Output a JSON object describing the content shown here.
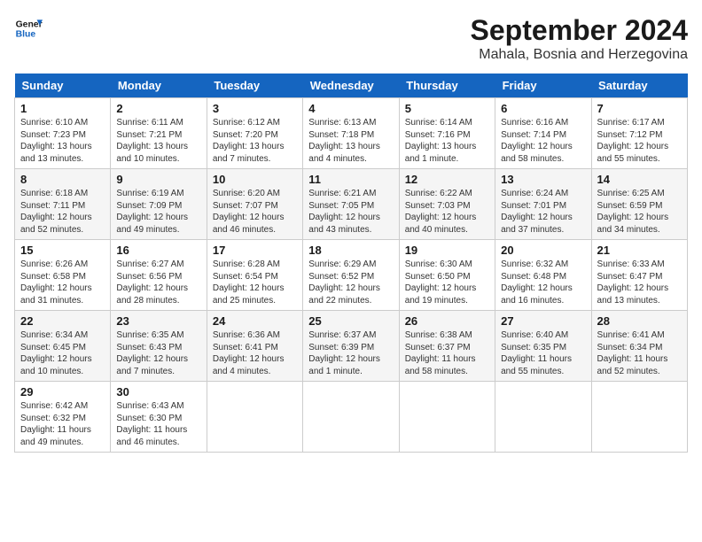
{
  "logo": {
    "line1": "General",
    "line2": "Blue"
  },
  "title": "September 2024",
  "location": "Mahala, Bosnia and Herzegovina",
  "days_of_week": [
    "Sunday",
    "Monday",
    "Tuesday",
    "Wednesday",
    "Thursday",
    "Friday",
    "Saturday"
  ],
  "weeks": [
    [
      {
        "day": "1",
        "sunrise": "Sunrise: 6:10 AM",
        "sunset": "Sunset: 7:23 PM",
        "daylight": "Daylight: 13 hours and 13 minutes."
      },
      {
        "day": "2",
        "sunrise": "Sunrise: 6:11 AM",
        "sunset": "Sunset: 7:21 PM",
        "daylight": "Daylight: 13 hours and 10 minutes."
      },
      {
        "day": "3",
        "sunrise": "Sunrise: 6:12 AM",
        "sunset": "Sunset: 7:20 PM",
        "daylight": "Daylight: 13 hours and 7 minutes."
      },
      {
        "day": "4",
        "sunrise": "Sunrise: 6:13 AM",
        "sunset": "Sunset: 7:18 PM",
        "daylight": "Daylight: 13 hours and 4 minutes."
      },
      {
        "day": "5",
        "sunrise": "Sunrise: 6:14 AM",
        "sunset": "Sunset: 7:16 PM",
        "daylight": "Daylight: 13 hours and 1 minute."
      },
      {
        "day": "6",
        "sunrise": "Sunrise: 6:16 AM",
        "sunset": "Sunset: 7:14 PM",
        "daylight": "Daylight: 12 hours and 58 minutes."
      },
      {
        "day": "7",
        "sunrise": "Sunrise: 6:17 AM",
        "sunset": "Sunset: 7:12 PM",
        "daylight": "Daylight: 12 hours and 55 minutes."
      }
    ],
    [
      {
        "day": "8",
        "sunrise": "Sunrise: 6:18 AM",
        "sunset": "Sunset: 7:11 PM",
        "daylight": "Daylight: 12 hours and 52 minutes."
      },
      {
        "day": "9",
        "sunrise": "Sunrise: 6:19 AM",
        "sunset": "Sunset: 7:09 PM",
        "daylight": "Daylight: 12 hours and 49 minutes."
      },
      {
        "day": "10",
        "sunrise": "Sunrise: 6:20 AM",
        "sunset": "Sunset: 7:07 PM",
        "daylight": "Daylight: 12 hours and 46 minutes."
      },
      {
        "day": "11",
        "sunrise": "Sunrise: 6:21 AM",
        "sunset": "Sunset: 7:05 PM",
        "daylight": "Daylight: 12 hours and 43 minutes."
      },
      {
        "day": "12",
        "sunrise": "Sunrise: 6:22 AM",
        "sunset": "Sunset: 7:03 PM",
        "daylight": "Daylight: 12 hours and 40 minutes."
      },
      {
        "day": "13",
        "sunrise": "Sunrise: 6:24 AM",
        "sunset": "Sunset: 7:01 PM",
        "daylight": "Daylight: 12 hours and 37 minutes."
      },
      {
        "day": "14",
        "sunrise": "Sunrise: 6:25 AM",
        "sunset": "Sunset: 6:59 PM",
        "daylight": "Daylight: 12 hours and 34 minutes."
      }
    ],
    [
      {
        "day": "15",
        "sunrise": "Sunrise: 6:26 AM",
        "sunset": "Sunset: 6:58 PM",
        "daylight": "Daylight: 12 hours and 31 minutes."
      },
      {
        "day": "16",
        "sunrise": "Sunrise: 6:27 AM",
        "sunset": "Sunset: 6:56 PM",
        "daylight": "Daylight: 12 hours and 28 minutes."
      },
      {
        "day": "17",
        "sunrise": "Sunrise: 6:28 AM",
        "sunset": "Sunset: 6:54 PM",
        "daylight": "Daylight: 12 hours and 25 minutes."
      },
      {
        "day": "18",
        "sunrise": "Sunrise: 6:29 AM",
        "sunset": "Sunset: 6:52 PM",
        "daylight": "Daylight: 12 hours and 22 minutes."
      },
      {
        "day": "19",
        "sunrise": "Sunrise: 6:30 AM",
        "sunset": "Sunset: 6:50 PM",
        "daylight": "Daylight: 12 hours and 19 minutes."
      },
      {
        "day": "20",
        "sunrise": "Sunrise: 6:32 AM",
        "sunset": "Sunset: 6:48 PM",
        "daylight": "Daylight: 12 hours and 16 minutes."
      },
      {
        "day": "21",
        "sunrise": "Sunrise: 6:33 AM",
        "sunset": "Sunset: 6:47 PM",
        "daylight": "Daylight: 12 hours and 13 minutes."
      }
    ],
    [
      {
        "day": "22",
        "sunrise": "Sunrise: 6:34 AM",
        "sunset": "Sunset: 6:45 PM",
        "daylight": "Daylight: 12 hours and 10 minutes."
      },
      {
        "day": "23",
        "sunrise": "Sunrise: 6:35 AM",
        "sunset": "Sunset: 6:43 PM",
        "daylight": "Daylight: 12 hours and 7 minutes."
      },
      {
        "day": "24",
        "sunrise": "Sunrise: 6:36 AM",
        "sunset": "Sunset: 6:41 PM",
        "daylight": "Daylight: 12 hours and 4 minutes."
      },
      {
        "day": "25",
        "sunrise": "Sunrise: 6:37 AM",
        "sunset": "Sunset: 6:39 PM",
        "daylight": "Daylight: 12 hours and 1 minute."
      },
      {
        "day": "26",
        "sunrise": "Sunrise: 6:38 AM",
        "sunset": "Sunset: 6:37 PM",
        "daylight": "Daylight: 11 hours and 58 minutes."
      },
      {
        "day": "27",
        "sunrise": "Sunrise: 6:40 AM",
        "sunset": "Sunset: 6:35 PM",
        "daylight": "Daylight: 11 hours and 55 minutes."
      },
      {
        "day": "28",
        "sunrise": "Sunrise: 6:41 AM",
        "sunset": "Sunset: 6:34 PM",
        "daylight": "Daylight: 11 hours and 52 minutes."
      }
    ],
    [
      {
        "day": "29",
        "sunrise": "Sunrise: 6:42 AM",
        "sunset": "Sunset: 6:32 PM",
        "daylight": "Daylight: 11 hours and 49 minutes."
      },
      {
        "day": "30",
        "sunrise": "Sunrise: 6:43 AM",
        "sunset": "Sunset: 6:30 PM",
        "daylight": "Daylight: 11 hours and 46 minutes."
      },
      null,
      null,
      null,
      null,
      null
    ]
  ]
}
